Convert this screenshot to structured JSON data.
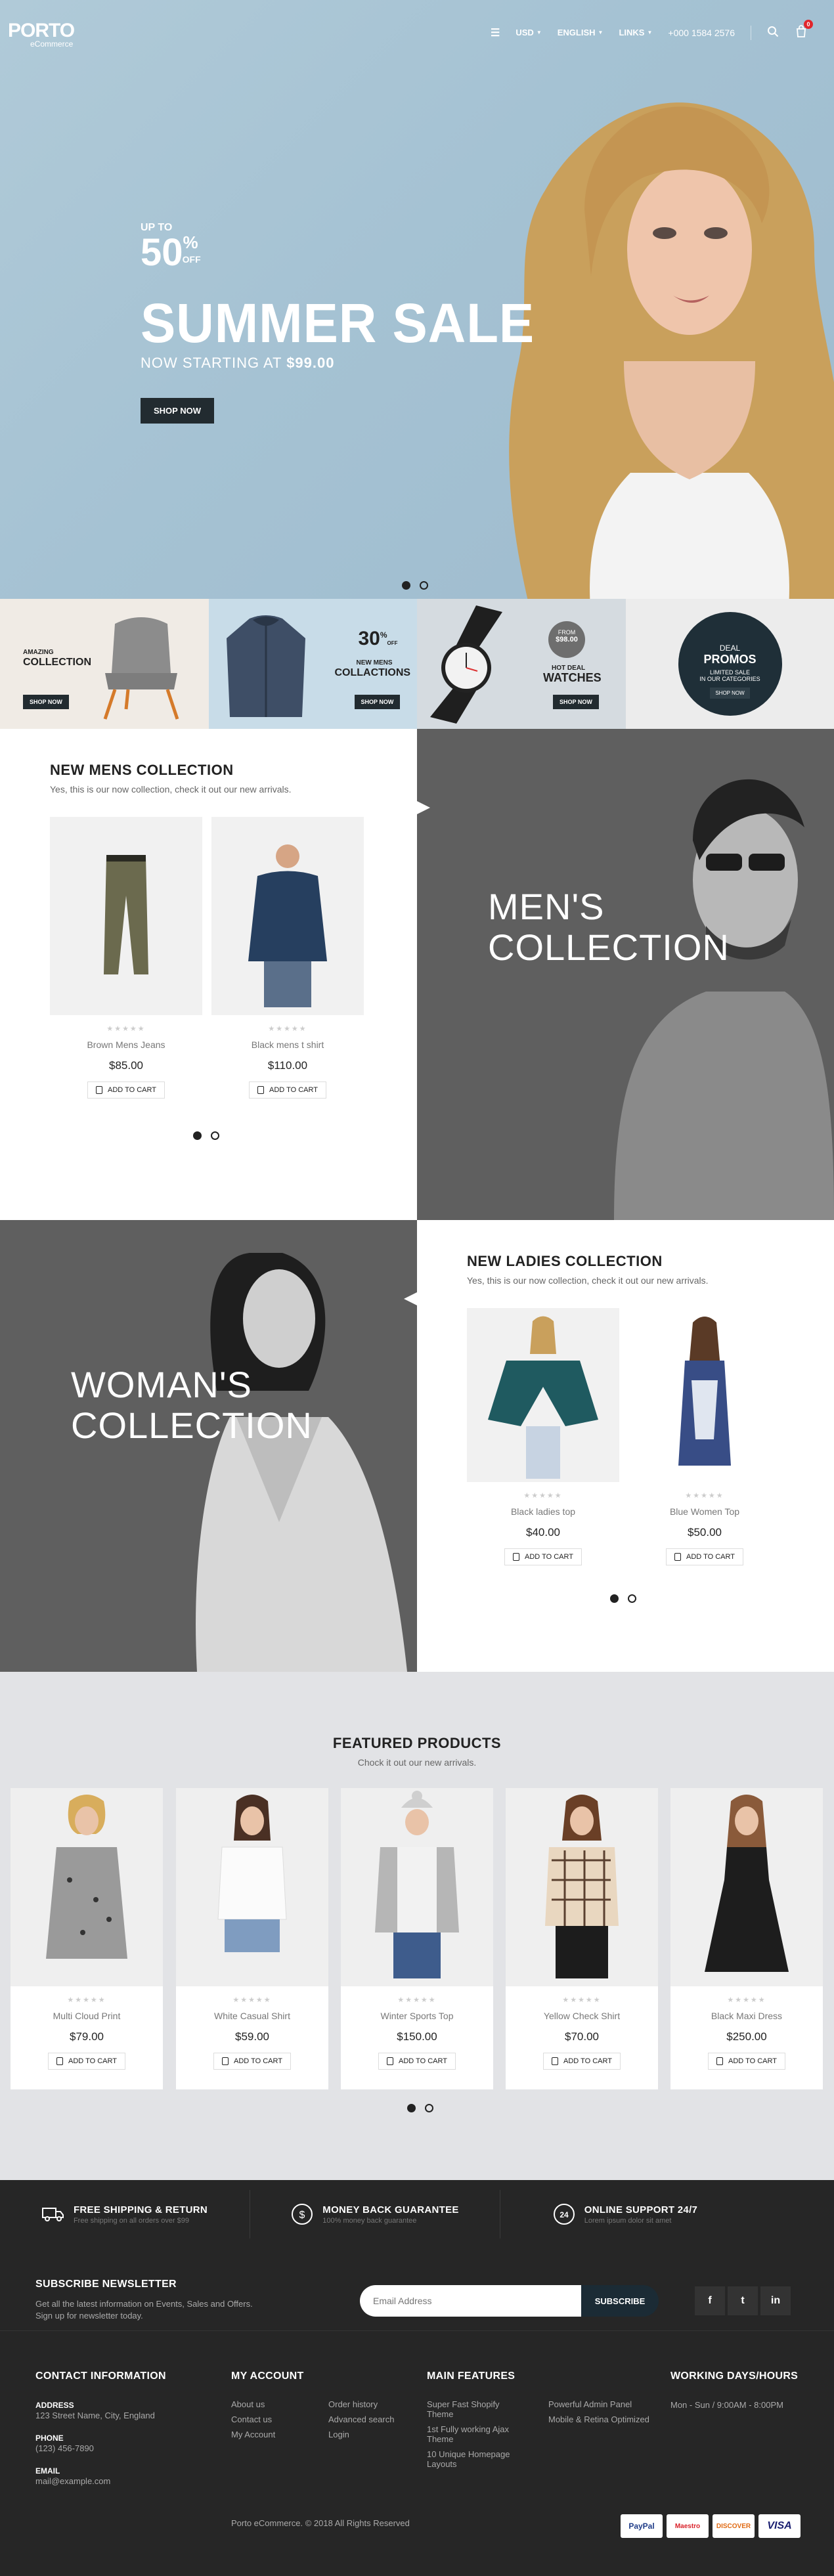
{
  "header": {
    "logo": "PORTO",
    "logo_sub": "eCommerce",
    "currency": "USD",
    "language": "ENGLISH",
    "links": "LINKS",
    "phone": "+000 1584 2576",
    "cart_count": "0"
  },
  "hero": {
    "up_to": "UP TO",
    "percent": "50",
    "percent_sign": "%",
    "off": "OFF",
    "title": "SUMMER SALE",
    "starting_prefix": "NOW STARTING AT",
    "starting_price": "$99.00",
    "button": "SHOP NOW"
  },
  "banners": [
    {
      "small": "AMAZING",
      "title": "COLLECTION",
      "button": "SHOP NOW"
    },
    {
      "big": "30",
      "big_sup": "%",
      "big_off": "OFF",
      "small": "NEW MENS",
      "title": "COLLACTIONS",
      "button": "SHOP NOW"
    },
    {
      "badge_small": "FROM",
      "badge_price": "$98.00",
      "small": "HOT DEAL",
      "title": "WATCHES",
      "button": "SHOP NOW"
    },
    {
      "deal": "DEAL",
      "promos": "PROMOS",
      "line1": "LIMITED SALE",
      "line2": "IN OUR CATEGORIES",
      "button": "SHOP NOW"
    }
  ],
  "mens": {
    "title": "NEW MENS COLLECTION",
    "subtitle": "Yes, this is our now collection, check it out our new arrivals.",
    "collection_line1": "MEN'S",
    "collection_line2": "COLLECTION",
    "products": [
      {
        "name": "Brown Mens Jeans",
        "price": "$85.00",
        "button": "ADD TO CART"
      },
      {
        "name": "Black mens t shirt",
        "price": "$110.00",
        "button": "ADD TO CART"
      }
    ]
  },
  "ladies": {
    "title": "NEW LADIES COLLECTION",
    "subtitle": "Yes, this is our now collection, check it out our new arrivals.",
    "collection_line1": "WOMAN'S",
    "collection_line2": "COLLECTION",
    "products": [
      {
        "name": "Black ladies top",
        "price": "$40.00",
        "button": "ADD TO CART"
      },
      {
        "name": "Blue Women Top",
        "price": "$50.00",
        "button": "ADD TO CART"
      }
    ]
  },
  "featured": {
    "title": "FEATURED PRODUCTS",
    "subtitle": "Chock it out our new arrivals.",
    "products": [
      {
        "name": "Multi Cloud Print",
        "price": "$79.00",
        "button": "ADD TO CART"
      },
      {
        "name": "White Casual Shirt",
        "price": "$59.00",
        "button": "ADD TO CART"
      },
      {
        "name": "Winter Sports Top",
        "price": "$150.00",
        "button": "ADD TO CART"
      },
      {
        "name": "Yellow Check Shirt",
        "price": "$70.00",
        "button": "ADD TO CART"
      },
      {
        "name": "Black Maxi Dress",
        "price": "$250.00",
        "button": "ADD TO CART"
      }
    ]
  },
  "features_bar": [
    {
      "title": "FREE SHIPPING & RETURN",
      "sub": "Free shipping on all orders over $99",
      "icon": "truck-icon"
    },
    {
      "title": "MONEY BACK GUARANTEE",
      "sub": "100% money back guarantee",
      "icon": "dollar-icon"
    },
    {
      "title": "ONLINE SUPPORT 24/7",
      "sub": "Lorem ipsum dolor sit amet",
      "icon": "support-24-icon"
    }
  ],
  "newsletter": {
    "title": "SUBSCRIBE NEWSLETTER",
    "text_line1": "Get all the latest information on Events, Sales and Offers.",
    "text_line2": "Sign up for newsletter today.",
    "placeholder": "Email Address",
    "button": "SUBSCRIBE"
  },
  "social": [
    "f",
    "t",
    "in"
  ],
  "contact": {
    "title": "CONTACT INFORMATION",
    "address_label": "ADDRESS",
    "address": "123 Street Name, City, England",
    "phone_label": "PHONE",
    "phone": "(123) 456-7890",
    "email_label": "EMAIL",
    "email": "mail@example.com"
  },
  "my_account": {
    "title": "MY ACCOUNT",
    "col1": [
      "About us",
      "Contact us",
      "My Account"
    ],
    "col2": [
      "Order history",
      "Advanced search",
      "Login"
    ]
  },
  "main_features": {
    "title": "MAIN FEATURES",
    "col1": [
      "Super Fast Shopify Theme",
      "1st Fully working Ajax Theme",
      "10 Unique Homepage Layouts"
    ],
    "col2": [
      "Powerful Admin Panel",
      "Mobile & Retina Optimized"
    ]
  },
  "working": {
    "title": "WORKING DAYS/HOURS",
    "text": "Mon - Sun / 9:00AM - 8:00PM"
  },
  "copyright": "Porto eCommerce. © 2018 All Rights Reserved",
  "payments": [
    "PayPal",
    "Maestro",
    "DISCOVER",
    "VISA"
  ]
}
